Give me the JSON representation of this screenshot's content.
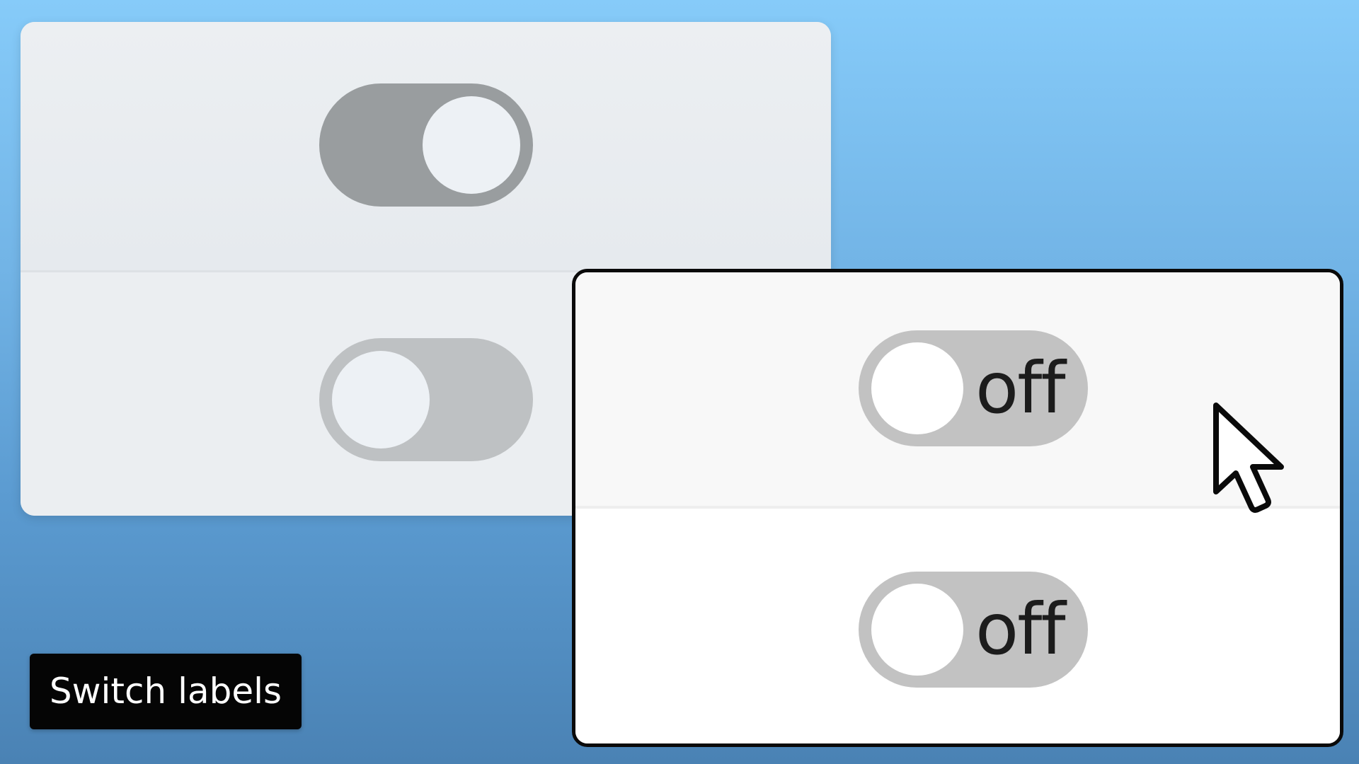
{
  "back_panel": {
    "switches": [
      {
        "state": "on"
      },
      {
        "state": "off"
      }
    ]
  },
  "front_panel": {
    "switches": [
      {
        "state": "off",
        "label": "off"
      },
      {
        "state": "off",
        "label": "off"
      }
    ]
  },
  "caption": {
    "text": "Switch labels"
  },
  "cursor": {
    "icon": "arrow-pointer-icon"
  },
  "colors": {
    "background_top": "#86cbf9",
    "background_bottom": "#4a82b4",
    "back_switch_on_track": "#999d9f",
    "back_switch_off_track": "#bec1c3",
    "front_switch_track": "#c2c2c2",
    "caption_bg": "#050505"
  }
}
